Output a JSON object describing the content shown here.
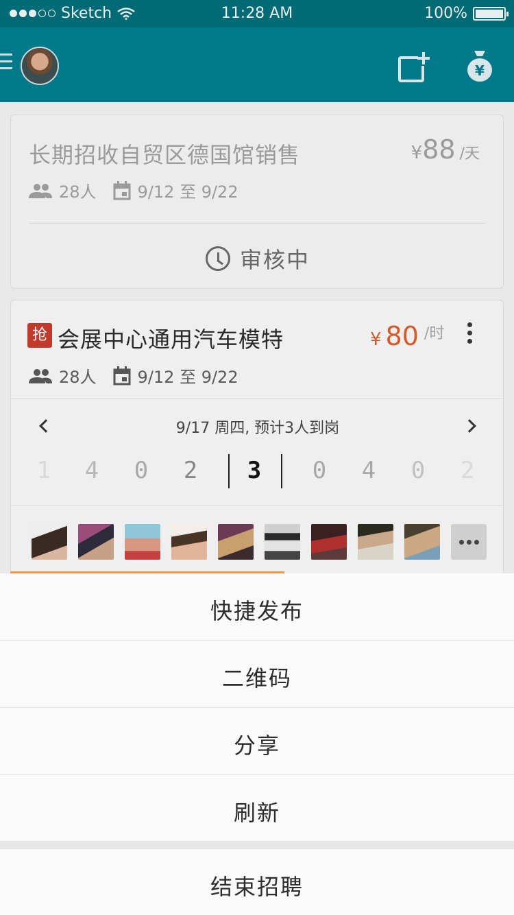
{
  "status_bar": {
    "carrier": "Sketch",
    "time": "11:28 AM",
    "battery": "100%"
  },
  "navbar": {
    "menu_icon": "menu-icon",
    "post_icon": "new-post-icon",
    "wallet_icon": "money-bag-icon"
  },
  "jobs": [
    {
      "title": "长期招收自贸区德国馆销售",
      "price_symbol": "¥",
      "price": "88",
      "unit": "/天",
      "people": "28人",
      "dates": "9/12 至 9/22",
      "status": "审核中"
    },
    {
      "badge": "抢",
      "title": "会展中心通用汽车模特",
      "price_symbol": "¥",
      "price": "80",
      "unit": "/时",
      "people": "28人",
      "dates": "9/12 至 9/22",
      "day_summary": "9/17 周四, 预计3人到岗",
      "day_counts": [
        "1",
        "4",
        "0",
        "2",
        "3",
        "0",
        "4",
        "0",
        "2"
      ],
      "selected_index": 4
    }
  ],
  "action_sheet": {
    "options": [
      "快捷发布",
      "二维码",
      "分享",
      "刷新"
    ],
    "cancel": "结束招聘"
  },
  "colors": {
    "nav": "#00798a",
    "status_bar": "#006a75",
    "rush": "#c0392b",
    "price": "#d45a2a"
  }
}
